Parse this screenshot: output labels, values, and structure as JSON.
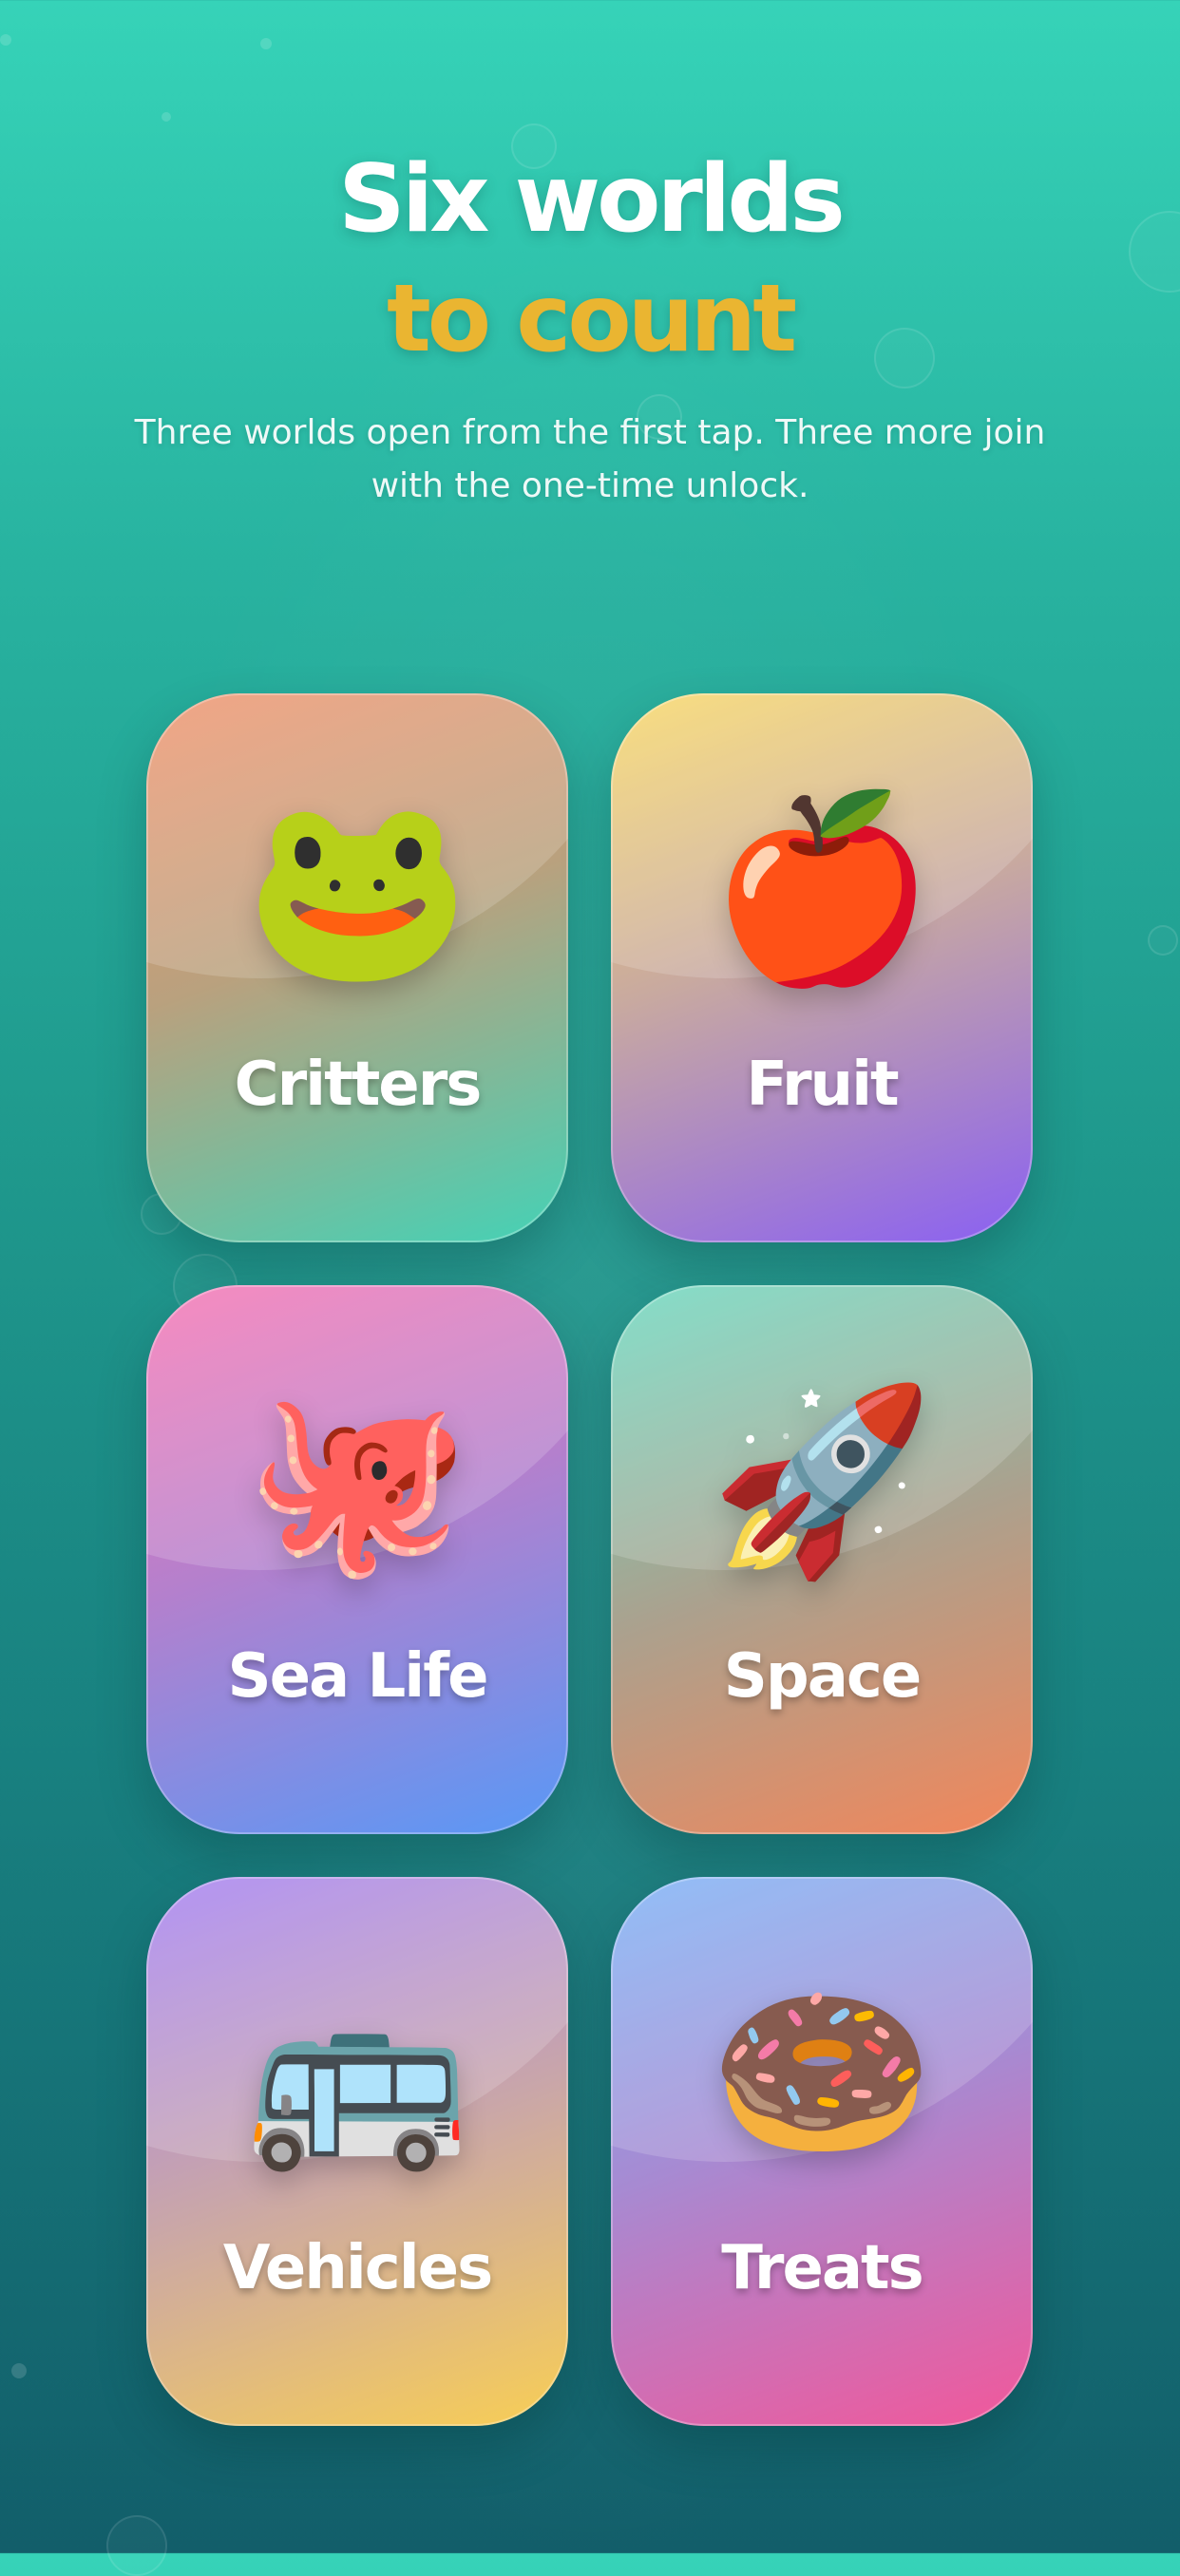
{
  "header": {
    "title_line1": "Six worlds",
    "title_line2": "to count",
    "subtitle": "Three worlds open from the first tap. Three more join with the one-time unlock."
  },
  "worlds": [
    {
      "label": "Critters",
      "icon": "frog-icon",
      "emoji": "🐸"
    },
    {
      "label": "Fruit",
      "icon": "apple-icon",
      "emoji": "🍎"
    },
    {
      "label": "Sea Life",
      "icon": "octopus-icon",
      "emoji": "🐙"
    },
    {
      "label": "Space",
      "icon": "rocket-icon",
      "emoji": "🚀"
    },
    {
      "label": "Vehicles",
      "icon": "bus-icon",
      "emoji": "🚌"
    },
    {
      "label": "Treats",
      "icon": "doughnut-icon",
      "emoji": "🍩"
    }
  ],
  "colors": {
    "background_top": "#36d3b8",
    "background_bottom": "#125e6a",
    "title_primary": "#ffffff",
    "title_accent": "#eab531"
  }
}
